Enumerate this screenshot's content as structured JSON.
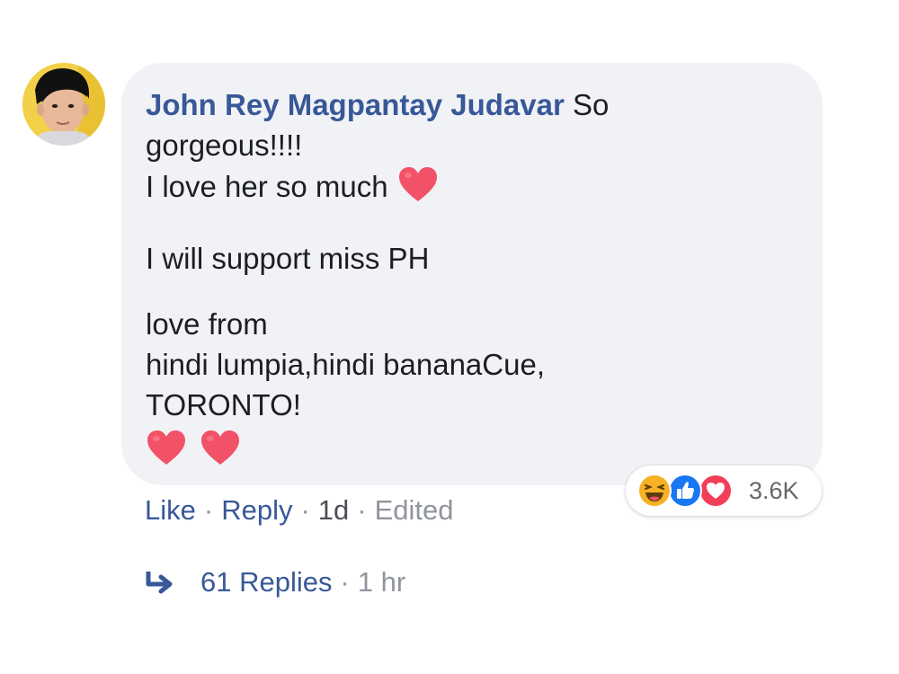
{
  "comment": {
    "author": "John Rey Magpantay Judavar",
    "text_first": "So",
    "text_line2": "gorgeous!!!!",
    "text_line3": "I love her so much",
    "text_para2": "I will support miss PH",
    "text_para3_line1": "love from",
    "text_para3_line2": "hindi lumpia,hindi bananaCue,",
    "text_para3_line3": "TORONTO!",
    "emoji": "heart-emoji"
  },
  "reactions": {
    "icons": [
      "haha-icon",
      "like-icon",
      "love-icon"
    ],
    "count": "3.6K"
  },
  "actions": {
    "like_label": "Like",
    "reply_label": "Reply",
    "time": "1d",
    "edited": "Edited",
    "separator": "·"
  },
  "replies": {
    "label": "61 Replies",
    "time": "1 hr"
  },
  "colors": {
    "link": "#385898",
    "bubble": "#f1f2f6",
    "heart": "#f25268",
    "like_blue": "#1877f2",
    "love_red": "#f33e58",
    "haha_yellow": "#f7b125"
  }
}
